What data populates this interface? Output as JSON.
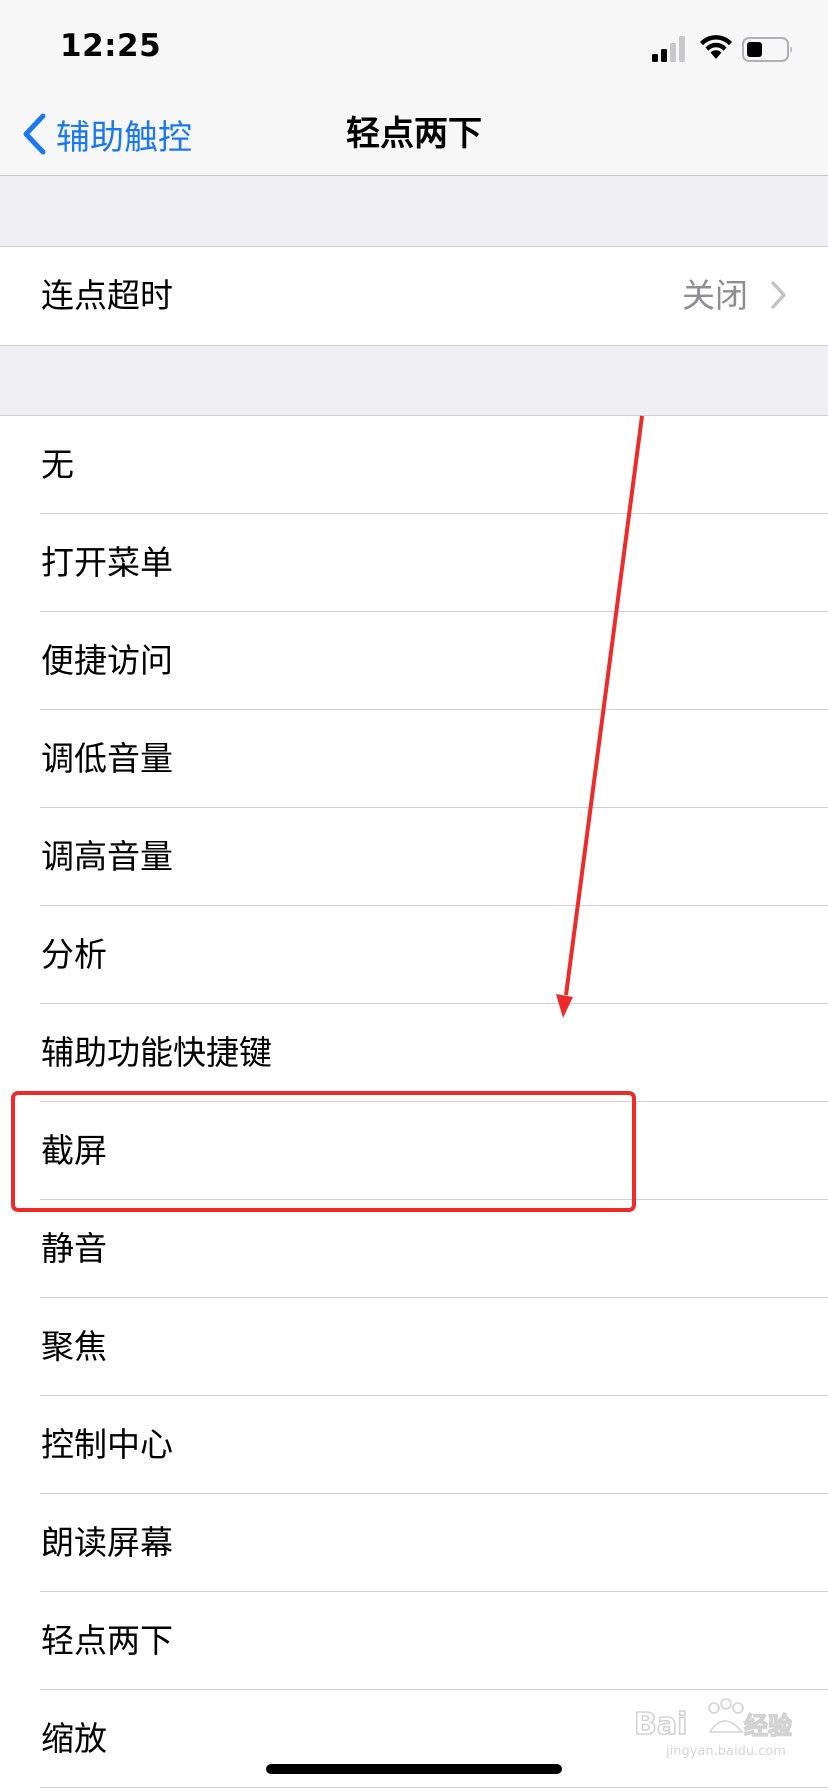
{
  "status_bar": {
    "time": "12:25",
    "icons": [
      "cellular-signal-icon",
      "wifi-icon",
      "battery-icon"
    ]
  },
  "nav": {
    "back_label": "辅助触控",
    "title": "轻点两下"
  },
  "timeout": {
    "label": "连点超时",
    "value": "关闭"
  },
  "actions": [
    "无",
    "打开菜单",
    "便捷访问",
    "调低音量",
    "调高音量",
    "分析",
    "辅助功能快捷键",
    "截屏",
    "静音",
    "聚焦",
    "控制中心",
    "朗读屏幕",
    "轻点两下",
    "缩放"
  ],
  "highlighted_action": "截屏",
  "colors": {
    "accent": "#1a78f1",
    "annotation": "#ee2b2b",
    "background": "#efeff4"
  },
  "watermark": {
    "text": "jingyan.baidu.com"
  }
}
